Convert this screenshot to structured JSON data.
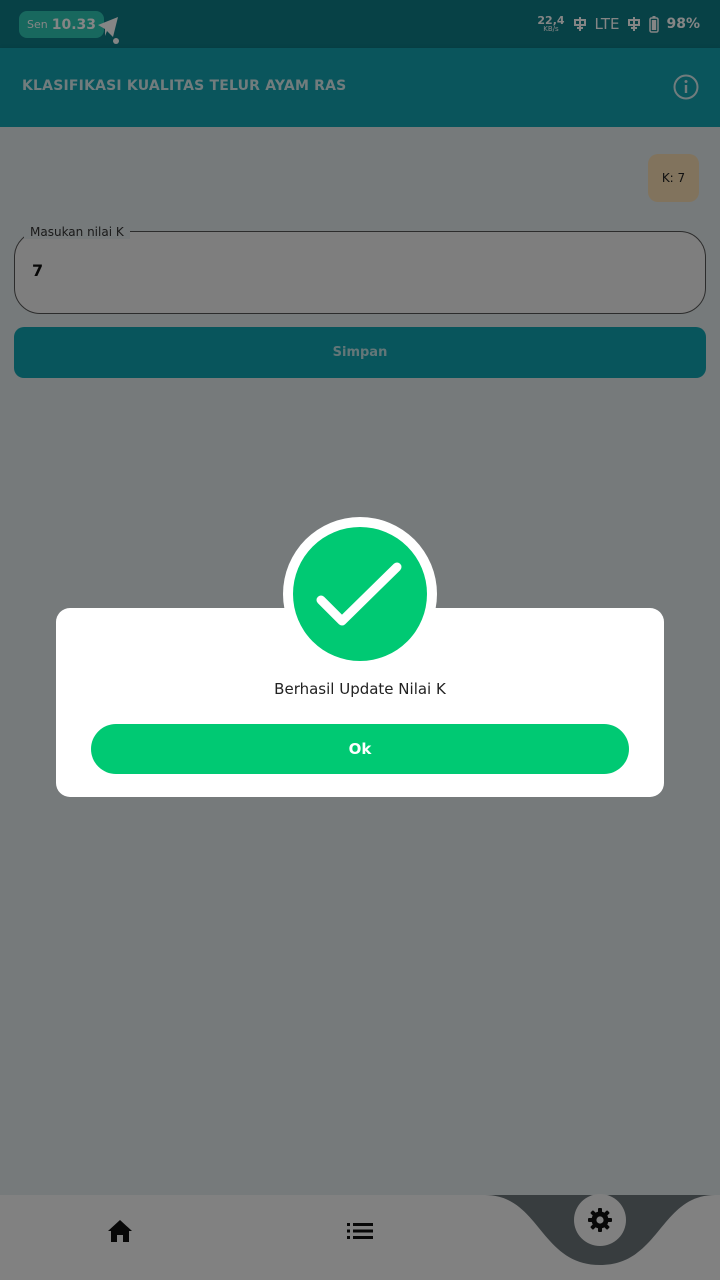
{
  "status_bar": {
    "day": "Sen",
    "time": "10.33",
    "net_speed": "22,4",
    "net_unit": "KB/s",
    "network": "LTE",
    "battery": "98%"
  },
  "app_bar": {
    "title": "KLASIFIKASI KUALITAS TELUR AYAM RAS",
    "info_icon": "info-icon"
  },
  "k_chip": "K: 7",
  "k_field": {
    "label": "Masukan nilai K",
    "value": "7"
  },
  "save_button": "Simpan",
  "dialog": {
    "icon": "check-icon",
    "message": "Berhasil Update Nilai K",
    "button": "Ok"
  },
  "bottom_nav": {
    "items": [
      "home-icon",
      "list-icon",
      "gear-icon"
    ]
  },
  "colors": {
    "primary": "#14a3b0",
    "status_bar": "#0e7d87",
    "success": "#00c973",
    "chip": "#f7dcb2"
  }
}
